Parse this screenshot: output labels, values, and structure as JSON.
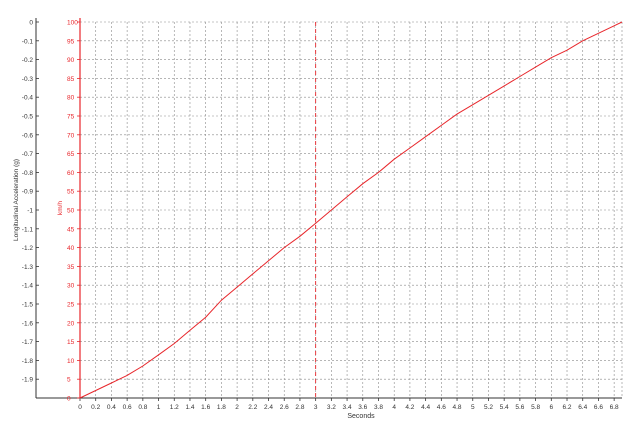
{
  "chart_data": {
    "type": "line",
    "title": "",
    "xlabel": "Seconds",
    "ylabel_left": "Longitudinal Acceleration (g)",
    "ylabel_right": "km/h",
    "xlim": [
      0,
      6.9
    ],
    "ylim_speed": [
      0,
      100
    ],
    "ylim_accel": [
      -2.0,
      0
    ],
    "x_ticks": [
      "0",
      "0.2",
      "0.4",
      "0.6",
      "0.8",
      "1",
      "1.2",
      "1.4",
      "1.6",
      "1.8",
      "2",
      "2.2",
      "2.4",
      "2.6",
      "2.8",
      "3",
      "3.2",
      "3.4",
      "3.6",
      "3.8",
      "4",
      "4.2",
      "4.4",
      "4.6",
      "4.8",
      "5",
      "5.2",
      "5.4",
      "5.6",
      "5.8",
      "6",
      "6.2",
      "6.4",
      "6.6",
      "6.8"
    ],
    "speed_ticks": [
      "0",
      "5",
      "10",
      "15",
      "20",
      "25",
      "30",
      "35",
      "40",
      "45",
      "50",
      "55",
      "60",
      "65",
      "70",
      "75",
      "80",
      "85",
      "90",
      "95",
      "100"
    ],
    "accel_ticks": [
      "0",
      "-0.1",
      "-0.2",
      "-0.3",
      "-0.4",
      "-0.5",
      "-0.6",
      "-0.7",
      "-0.8",
      "-0.9",
      "-1",
      "-1.1",
      "-1.2",
      "-1.3",
      "-1.4",
      "-1.5",
      "-1.6",
      "-1.7",
      "-1.8",
      "-1.9"
    ],
    "grid": true,
    "cursor_x": 3.0,
    "series": [
      {
        "axis": "speed",
        "color": "#e8262b",
        "x": [
          0,
          0.2,
          0.4,
          0.6,
          0.8,
          1.0,
          1.2,
          1.4,
          1.6,
          1.8,
          2.0,
          2.2,
          2.4,
          2.6,
          2.8,
          3.0,
          3.2,
          3.4,
          3.6,
          3.8,
          4.0,
          4.2,
          4.4,
          4.6,
          4.8,
          5.0,
          5.2,
          5.4,
          5.6,
          5.8,
          6.0,
          6.2,
          6.4,
          6.6,
          6.8,
          6.9
        ],
        "y": [
          0,
          2,
          4,
          6,
          8.5,
          11.5,
          14.5,
          18,
          21.5,
          26,
          29.5,
          33,
          36.5,
          40,
          43,
          46.5,
          50,
          53.5,
          57,
          60,
          63.5,
          66.5,
          69.5,
          72.5,
          75.5,
          78,
          80.5,
          83,
          85.5,
          88,
          90.5,
          92.5,
          95,
          97,
          99,
          100
        ]
      }
    ]
  }
}
